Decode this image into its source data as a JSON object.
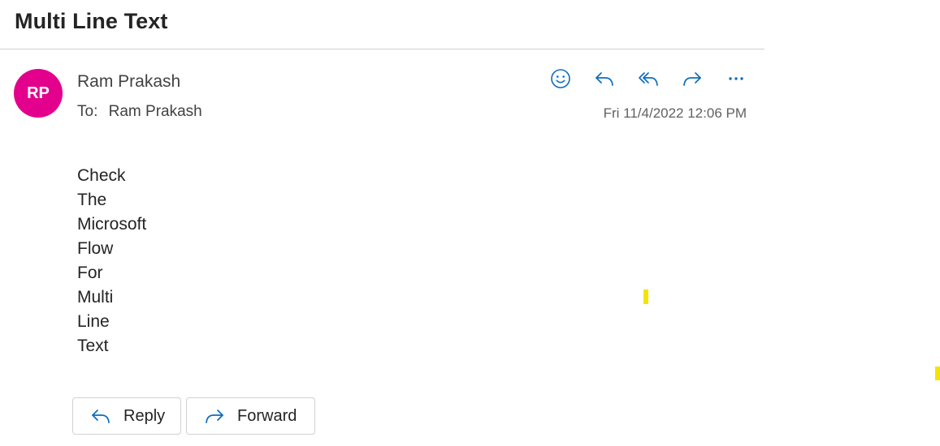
{
  "email": {
    "subject": "Multi Line Text",
    "sender": {
      "initials": "RP",
      "name": "Ram Prakash",
      "avatar_color": "#e3008c"
    },
    "to_label": "To:",
    "to_name": "Ram Prakash",
    "date": "Fri 11/4/2022 12:06 PM",
    "body_lines": [
      "Check",
      "The",
      "Microsoft",
      "Flow",
      "For",
      "Multi",
      "Line",
      "Text"
    ]
  },
  "toolbar": {
    "icons": [
      "emoji-icon",
      "reply-icon",
      "reply-all-icon",
      "forward-icon",
      "more-icon"
    ],
    "icon_color": "#0f6cbd"
  },
  "footer": {
    "reply_label": "Reply",
    "forward_label": "Forward"
  },
  "marker_color": "#f5e400"
}
